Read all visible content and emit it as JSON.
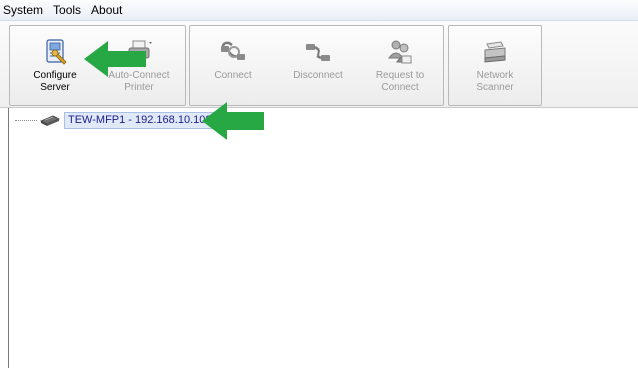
{
  "menu": {
    "items": [
      {
        "label": "System"
      },
      {
        "label": "Tools"
      },
      {
        "label": "About"
      }
    ]
  },
  "toolbar": {
    "configure_server": {
      "label": "Configure\nServer",
      "icon": "configure-server-icon",
      "enabled": true
    },
    "auto_connect_printer": {
      "label": "Auto-Connect\nPrinter",
      "icon": "printer-icon",
      "enabled": false
    },
    "connect": {
      "label": "Connect",
      "icon": "connect-icon",
      "enabled": false
    },
    "disconnect": {
      "label": "Disconnect",
      "icon": "disconnect-icon",
      "enabled": false
    },
    "request_to_connect": {
      "label": "Request to\nConnect",
      "icon": "request-connect-icon",
      "enabled": false
    },
    "network_scanner": {
      "label": "Network\nScanner",
      "icon": "scanner-icon",
      "enabled": false
    }
  },
  "tree": {
    "items": [
      {
        "label": "TEW-MFP1 - 192.168.10.102",
        "icon": "server-device-icon",
        "selected": true
      }
    ]
  },
  "colors": {
    "arrow": "#28a745",
    "selection": "#dfe9f8",
    "tree_text": "#1d1d8a"
  }
}
